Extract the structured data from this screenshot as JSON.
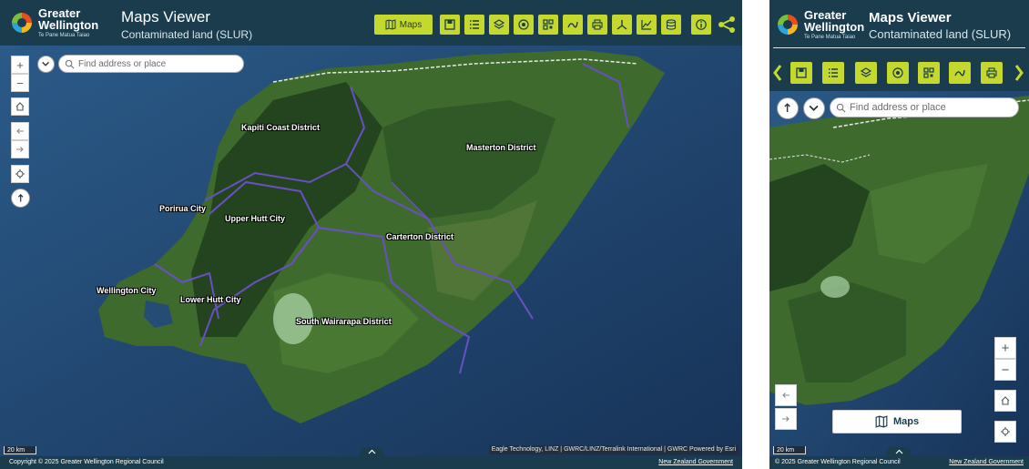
{
  "branding": {
    "logo_line1": "Greater",
    "logo_line2": "Wellington",
    "logo_line3": "Te Pane Matua Taiao"
  },
  "app": {
    "title": "Maps Viewer",
    "subtitle": "Contaminated land (SLUR)"
  },
  "toolbar": {
    "maps_label": "Maps",
    "tools": [
      "save-icon",
      "list-icon",
      "layers-icon",
      "target-icon",
      "qr-code-icon",
      "draw-icon",
      "print-icon",
      "measure-icon",
      "chart-icon",
      "database-icon",
      "info-icon"
    ],
    "share": "share-icon"
  },
  "search": {
    "placeholder": "Find address or place"
  },
  "districts": [
    "Kapiti Coast District",
    "Masterton District",
    "Porirua City",
    "Upper Hutt City",
    "Carterton District",
    "Wellington City",
    "Lower Hutt City",
    "South Wairarapa District"
  ],
  "map": {
    "scale": "20 km",
    "attribution": "Eagle Technology, LINZ | GWRC/LINZ/Terralink International | GWRC    Powered by Esri"
  },
  "footer": {
    "copyright": "Copyright © 2025 Greater Wellington Regional Council",
    "copyright_mobile": "© 2025 Greater Wellington Regional Council",
    "government": "New Zealand Government"
  },
  "mobile": {
    "maps_panel_label": "Maps"
  },
  "colors": {
    "header": "#1a3c4d",
    "accent": "#c5d82e",
    "boundary": "#6a4fc4",
    "ocean": "#1e3f66",
    "land": "#3f6a2e"
  }
}
